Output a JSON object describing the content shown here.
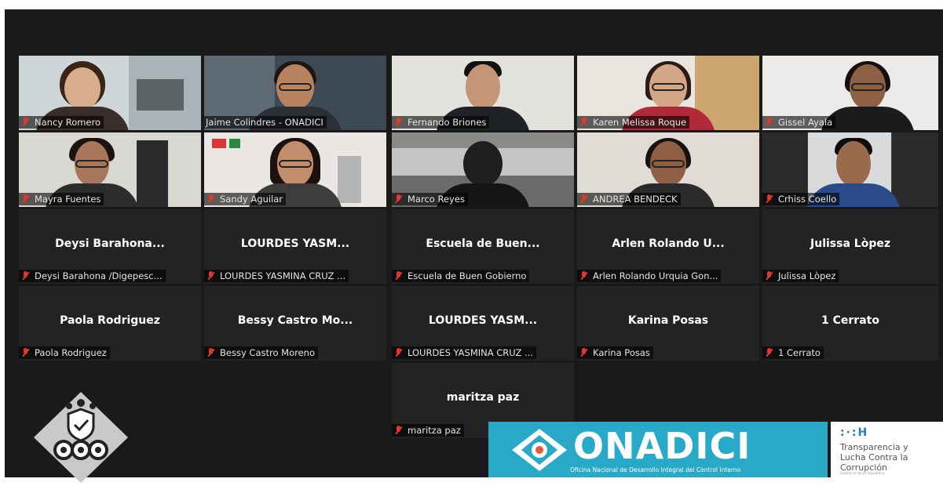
{
  "participants": [
    {
      "name": "Nancy Romero"
    },
    {
      "name": "Jaime Colindres - ONADICI"
    },
    {
      "name": "Fernando Briones"
    },
    {
      "name": "Karen Melissa Roque"
    },
    {
      "name": "Gissel Ayala"
    },
    {
      "name": "Mayra Fuentes"
    },
    {
      "name": "Sandy Aguilar"
    },
    {
      "name": "Marco Reyes"
    },
    {
      "name": "ANDREA BENDECK"
    },
    {
      "name": "Crhiss Coello"
    },
    {
      "title": "Deysi  Barahona...",
      "name": "Deysi Barahona /Digepesc..."
    },
    {
      "title": "LOURDES  YASM...",
      "name": "LOURDES YASMINA CRUZ ..."
    },
    {
      "title": "Escuela  de  Buen...",
      "name": "Escuela de Buen Gobierno"
    },
    {
      "title": "Arlen  Rolando  U...",
      "name": "Arlen Rolando Urquia Gon..."
    },
    {
      "title": "Julissa  Lòpez",
      "name": "Julissa Lòpez"
    },
    {
      "title": "Paola  Rodriguez",
      "name": "Paola Rodriguez"
    },
    {
      "title": "Bessy  Castro  Mo...",
      "name": "Bessy Castro Moreno"
    },
    {
      "title": "LOURDES  YASM...",
      "name": "LOURDES YASMINA CRUZ ..."
    },
    {
      "title": "Karina  Posas",
      "name": "Karina Posas"
    },
    {
      "title": "1  Cerrato",
      "name": "1 Cerrato"
    },
    {
      "title": "maritza  paz",
      "name": "maritza paz"
    }
  ],
  "branding": {
    "onadici_word": "ONADICI",
    "onadici_sub": "Oficina Nacional de Desarrollo Integral del Control Interno",
    "tlc_mark": ":·:H",
    "tlc_line1": "Transparencia y",
    "tlc_line2": "Lucha Contra la",
    "tlc_line3": "Corrupción",
    "tlc_tiny": "Gobierno de la República"
  },
  "colors": {
    "active_speaker": "#b6d23a",
    "muted_icon": "#e0382b",
    "onadici_bg": "#27a9c7"
  },
  "icons": {
    "muted": "microphone-muted-icon",
    "left_logo": "shield-gears-icon"
  }
}
